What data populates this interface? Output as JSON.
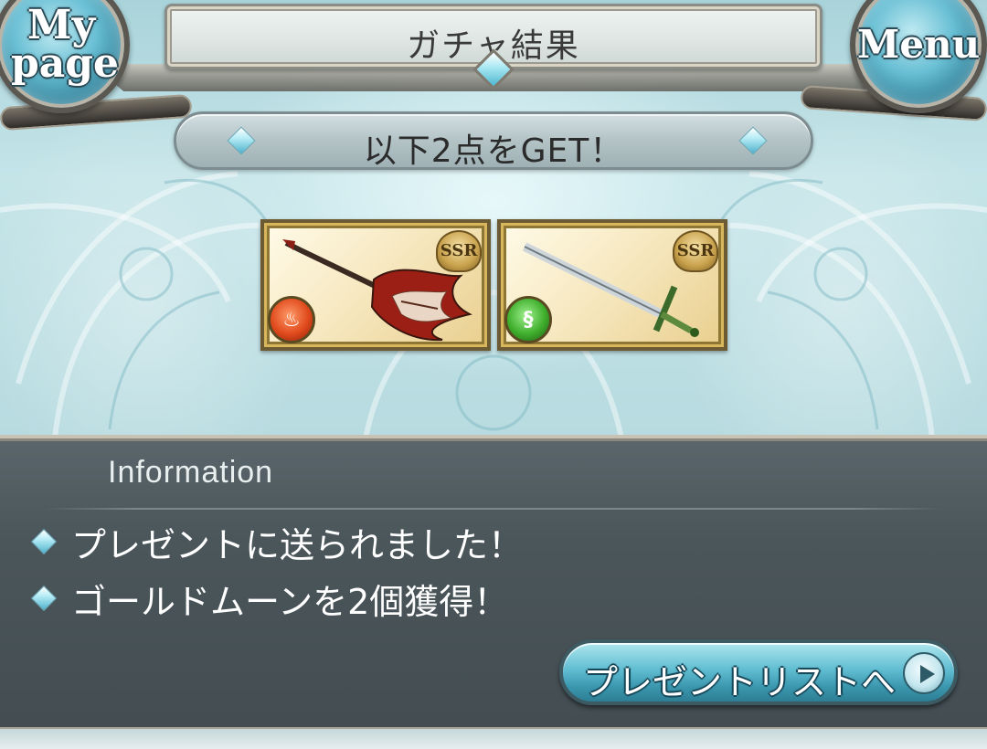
{
  "header": {
    "title": "ガチャ結果",
    "mypage_label": "My page",
    "menu_label": "Menu"
  },
  "result": {
    "banner": "以下2点をGET！",
    "items": [
      {
        "name": "weapon-guitar",
        "rarity": "SSR",
        "element": "fire",
        "element_icon": "flame-icon"
      },
      {
        "name": "weapon-sword",
        "rarity": "SSR",
        "element": "wind",
        "element_icon": "wind-icon"
      }
    ]
  },
  "info": {
    "title": "Information",
    "messages": [
      "プレゼントに送られました！",
      "ゴールドムーンを2個獲得！"
    ],
    "button_label": "プレゼントリストへ"
  },
  "colors": {
    "accent": "#61bed2",
    "panel": "#4b565b",
    "card_gold": "#d7b65c",
    "fire": "#e04a1c",
    "wind": "#3fae2c"
  }
}
